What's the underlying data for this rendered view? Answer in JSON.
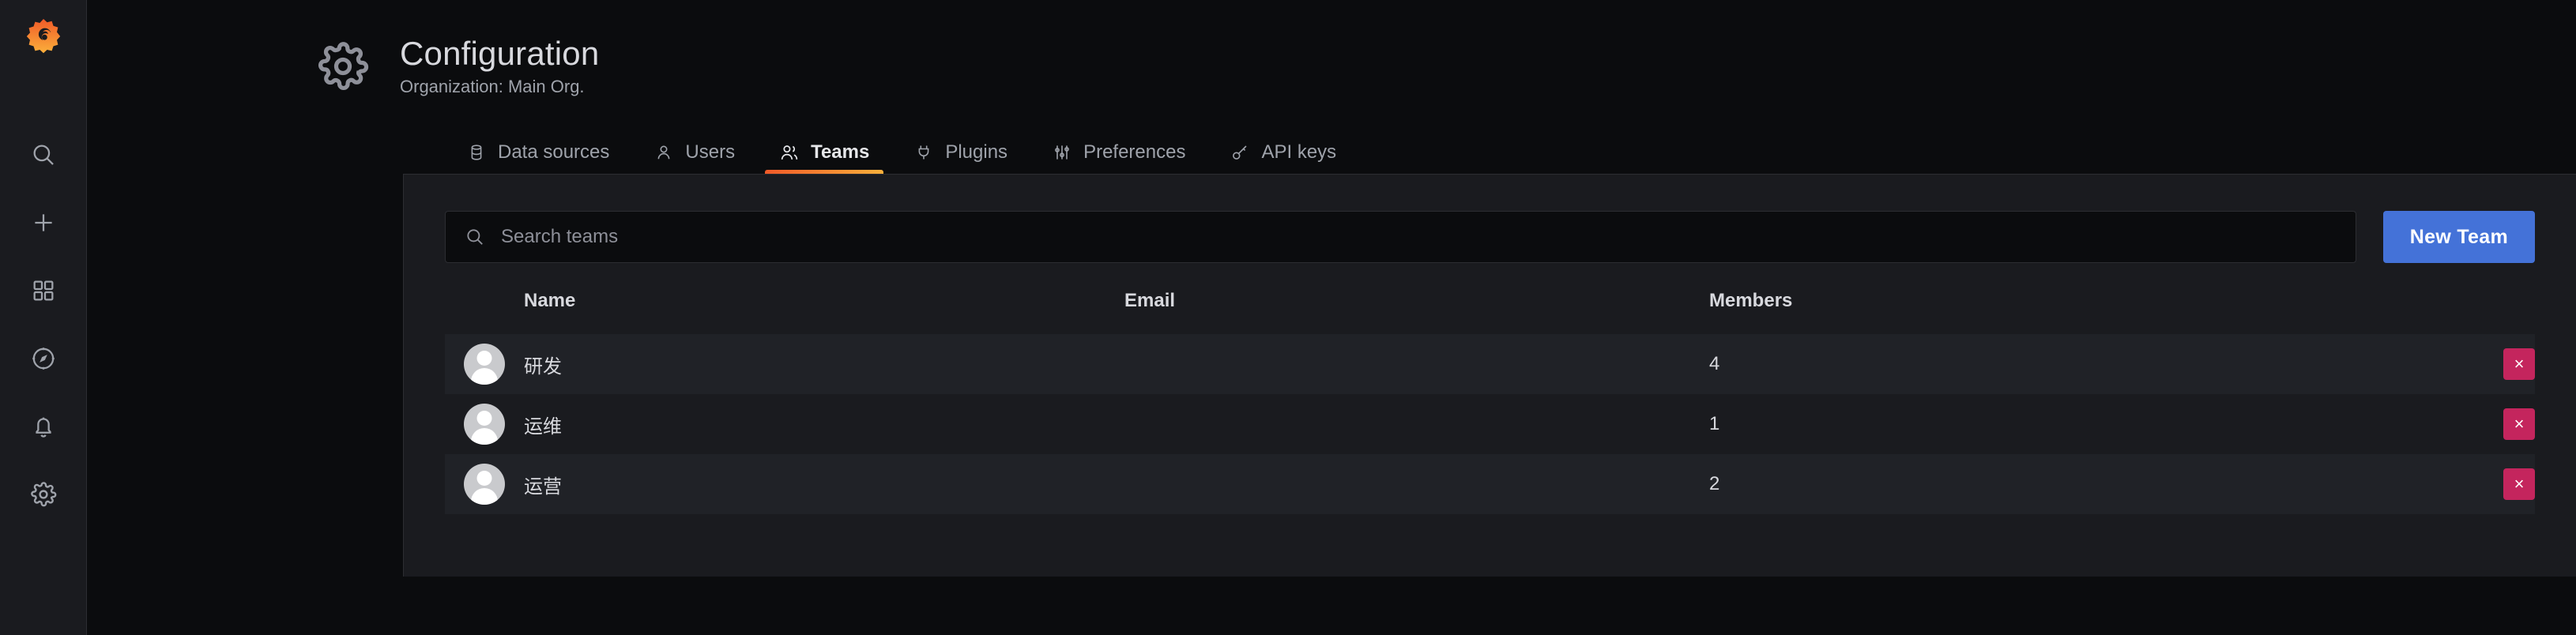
{
  "sidebar": {
    "logo": "grafana-logo",
    "items": [
      {
        "icon": "search-icon",
        "label": "Search"
      },
      {
        "icon": "plus-icon",
        "label": "Create"
      },
      {
        "icon": "dashboards-grid-icon",
        "label": "Dashboards"
      },
      {
        "icon": "compass-explore-icon",
        "label": "Explore"
      },
      {
        "icon": "bell-alerting-icon",
        "label": "Alerting"
      },
      {
        "icon": "gear-configuration-icon",
        "label": "Configuration"
      }
    ]
  },
  "header": {
    "icon": "gear-icon",
    "title": "Configuration",
    "subtitle": "Organization: Main Org."
  },
  "tabs": [
    {
      "label": "Data sources",
      "icon": "database-icon",
      "active": false
    },
    {
      "label": "Users",
      "icon": "user-icon",
      "active": false
    },
    {
      "label": "Teams",
      "icon": "users-icon",
      "active": true
    },
    {
      "label": "Plugins",
      "icon": "plug-icon",
      "active": false
    },
    {
      "label": "Preferences",
      "icon": "sliders-icon",
      "active": false
    },
    {
      "label": "API keys",
      "icon": "key-icon",
      "active": false
    }
  ],
  "toolbar": {
    "search": {
      "icon": "search-icon",
      "placeholder": "Search teams",
      "value": ""
    },
    "new_team_label": "New Team"
  },
  "table": {
    "columns": [
      "Name",
      "Email",
      "Members"
    ],
    "rows": [
      {
        "avatar": "avatar",
        "name": "研发",
        "email": "",
        "members": "4",
        "delete_label": "×"
      },
      {
        "avatar": "avatar",
        "name": "运维",
        "email": "",
        "members": "1",
        "delete_label": "×"
      },
      {
        "avatar": "avatar",
        "name": "运营",
        "email": "",
        "members": "2",
        "delete_label": "×"
      }
    ]
  },
  "colors": {
    "brand_orange": "#f05a28",
    "brand_yellow": "#fbb03b",
    "primary_button": "#4472d8",
    "delete_button": "#c4255d",
    "panel_bg": "#1a1b1f",
    "app_bg": "#0b0c0e",
    "row_stripe": "#202227",
    "border": "#2c2d32",
    "text_primary": "#d8d9de",
    "text_muted": "#9fa3ab"
  }
}
